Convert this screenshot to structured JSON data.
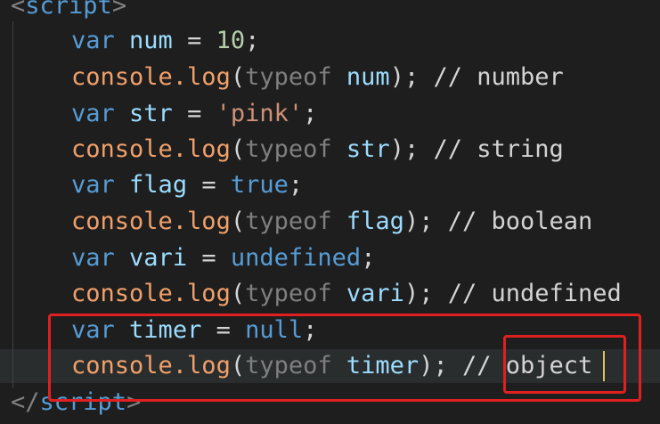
{
  "editor": {
    "open_tag": {
      "lt": "<",
      "name": "script",
      "gt": ">"
    },
    "close_tag": {
      "lt": "</",
      "name": "script",
      "gt": ">"
    },
    "lines": [
      {
        "kw": "var",
        "name": "num",
        "eq": "=",
        "value": "10",
        "semi": ";"
      },
      {
        "obj": "console",
        "method": ".log",
        "open": "(",
        "op": "typeof",
        "arg": "num",
        "close": ");",
        "comment": "// number"
      },
      {
        "kw": "var",
        "name": "str",
        "eq": "=",
        "value": "'pink'",
        "semi": ";"
      },
      {
        "obj": "console",
        "method": ".log",
        "open": "(",
        "op": "typeof",
        "arg": "str",
        "close": ");",
        "comment": "// string"
      },
      {
        "kw": "var",
        "name": "flag",
        "eq": "=",
        "value": "true",
        "semi": ";"
      },
      {
        "obj": "console",
        "method": ".log",
        "open": "(",
        "op": "typeof",
        "arg": "flag",
        "close": ");",
        "comment": "// boolean"
      },
      {
        "kw": "var",
        "name": "vari",
        "eq": "=",
        "value": "undefined",
        "semi": ";"
      },
      {
        "obj": "console",
        "method": ".log",
        "open": "(",
        "op": "typeof",
        "arg": "vari",
        "close": ");",
        "comment": "// undefined"
      },
      {
        "kw": "var",
        "name": "timer",
        "eq": "=",
        "value": "null",
        "semi": ";"
      },
      {
        "obj": "console",
        "method": ".log",
        "open": "(",
        "op": "typeof",
        "arg": "timer",
        "close": ");",
        "comment_prefix": "//",
        "comment_word": "object"
      }
    ]
  },
  "colors": {
    "background": "#1e1e1e",
    "keyword": "#569cd6",
    "identifier": "#9cdcfe",
    "number": "#b5cea8",
    "string": "#ce9178",
    "object": "#f0a06a",
    "function": "#dcdcaa",
    "annotation": "#e02020"
  }
}
